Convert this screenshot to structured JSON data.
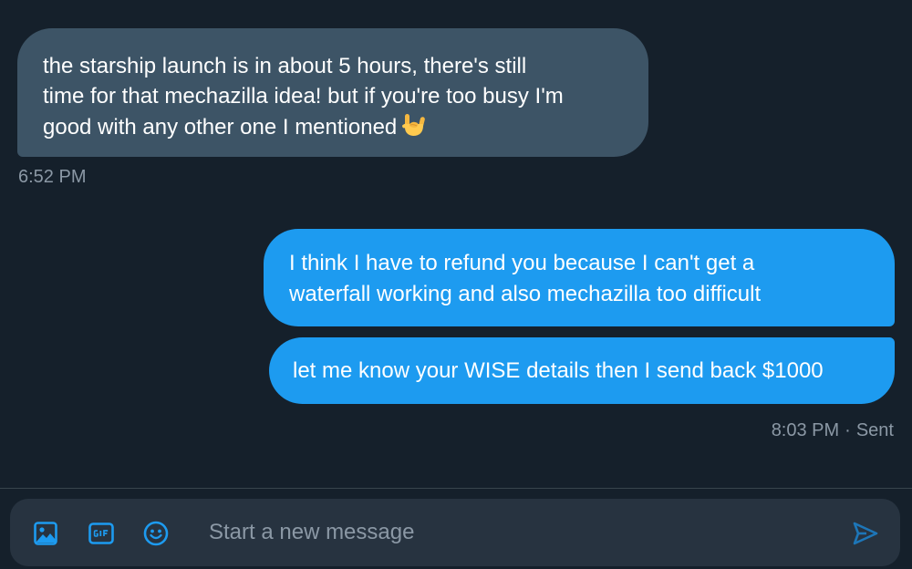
{
  "messages": {
    "incoming": {
      "lines": [
        "the starship launch is in about 5 hours, there's still",
        "time for that mechazilla idea! but if you're too busy I'm",
        "good with any other one I mentioned"
      ],
      "emoji_icon": "sign-of-the-horns-icon",
      "time": "6:52 PM"
    },
    "outgoing": [
      {
        "lines": [
          "I think I have to refund you because I can't get a",
          "waterfall working and also mechazilla too difficult"
        ]
      },
      {
        "text": "let me know your WISE details then I send back $1000"
      }
    ],
    "outgoing_time": "8:03 PM",
    "outgoing_separator": "·",
    "outgoing_status": "Sent"
  },
  "composer": {
    "placeholder": "Start a new message",
    "tools": [
      "image-icon",
      "gif-icon",
      "emoji-icon"
    ],
    "send_icon": "send-icon"
  },
  "colors": {
    "background": "#15202b",
    "incoming_bubble": "#3d5466",
    "outgoing_bubble": "#1d9bf0",
    "accent": "#1d9bf0",
    "muted_text": "#8b98a5",
    "composer_bg": "#273340"
  }
}
